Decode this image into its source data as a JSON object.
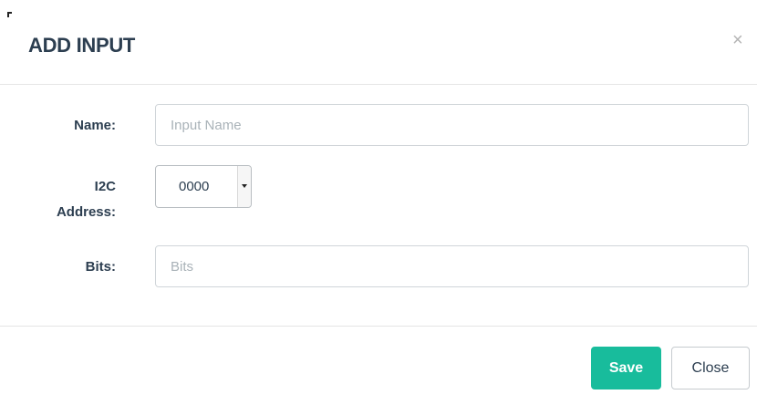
{
  "dialog": {
    "title": "ADD INPUT",
    "close_glyph": "×"
  },
  "form": {
    "name": {
      "label": "Name:",
      "value": "",
      "placeholder": "Input Name"
    },
    "i2c_address": {
      "label_line1": "I2C",
      "label_line2": "Address:",
      "selected": "0000"
    },
    "bits": {
      "label": "Bits:",
      "value": "",
      "placeholder": "Bits"
    }
  },
  "footer": {
    "save_label": "Save",
    "close_label": "Close"
  },
  "colors": {
    "accent": "#18bc9c",
    "text": "#2c3e50",
    "border": "#e5e5e5"
  },
  "icons": {
    "close": "close-icon",
    "dropdown": "chevron-down-icon"
  }
}
